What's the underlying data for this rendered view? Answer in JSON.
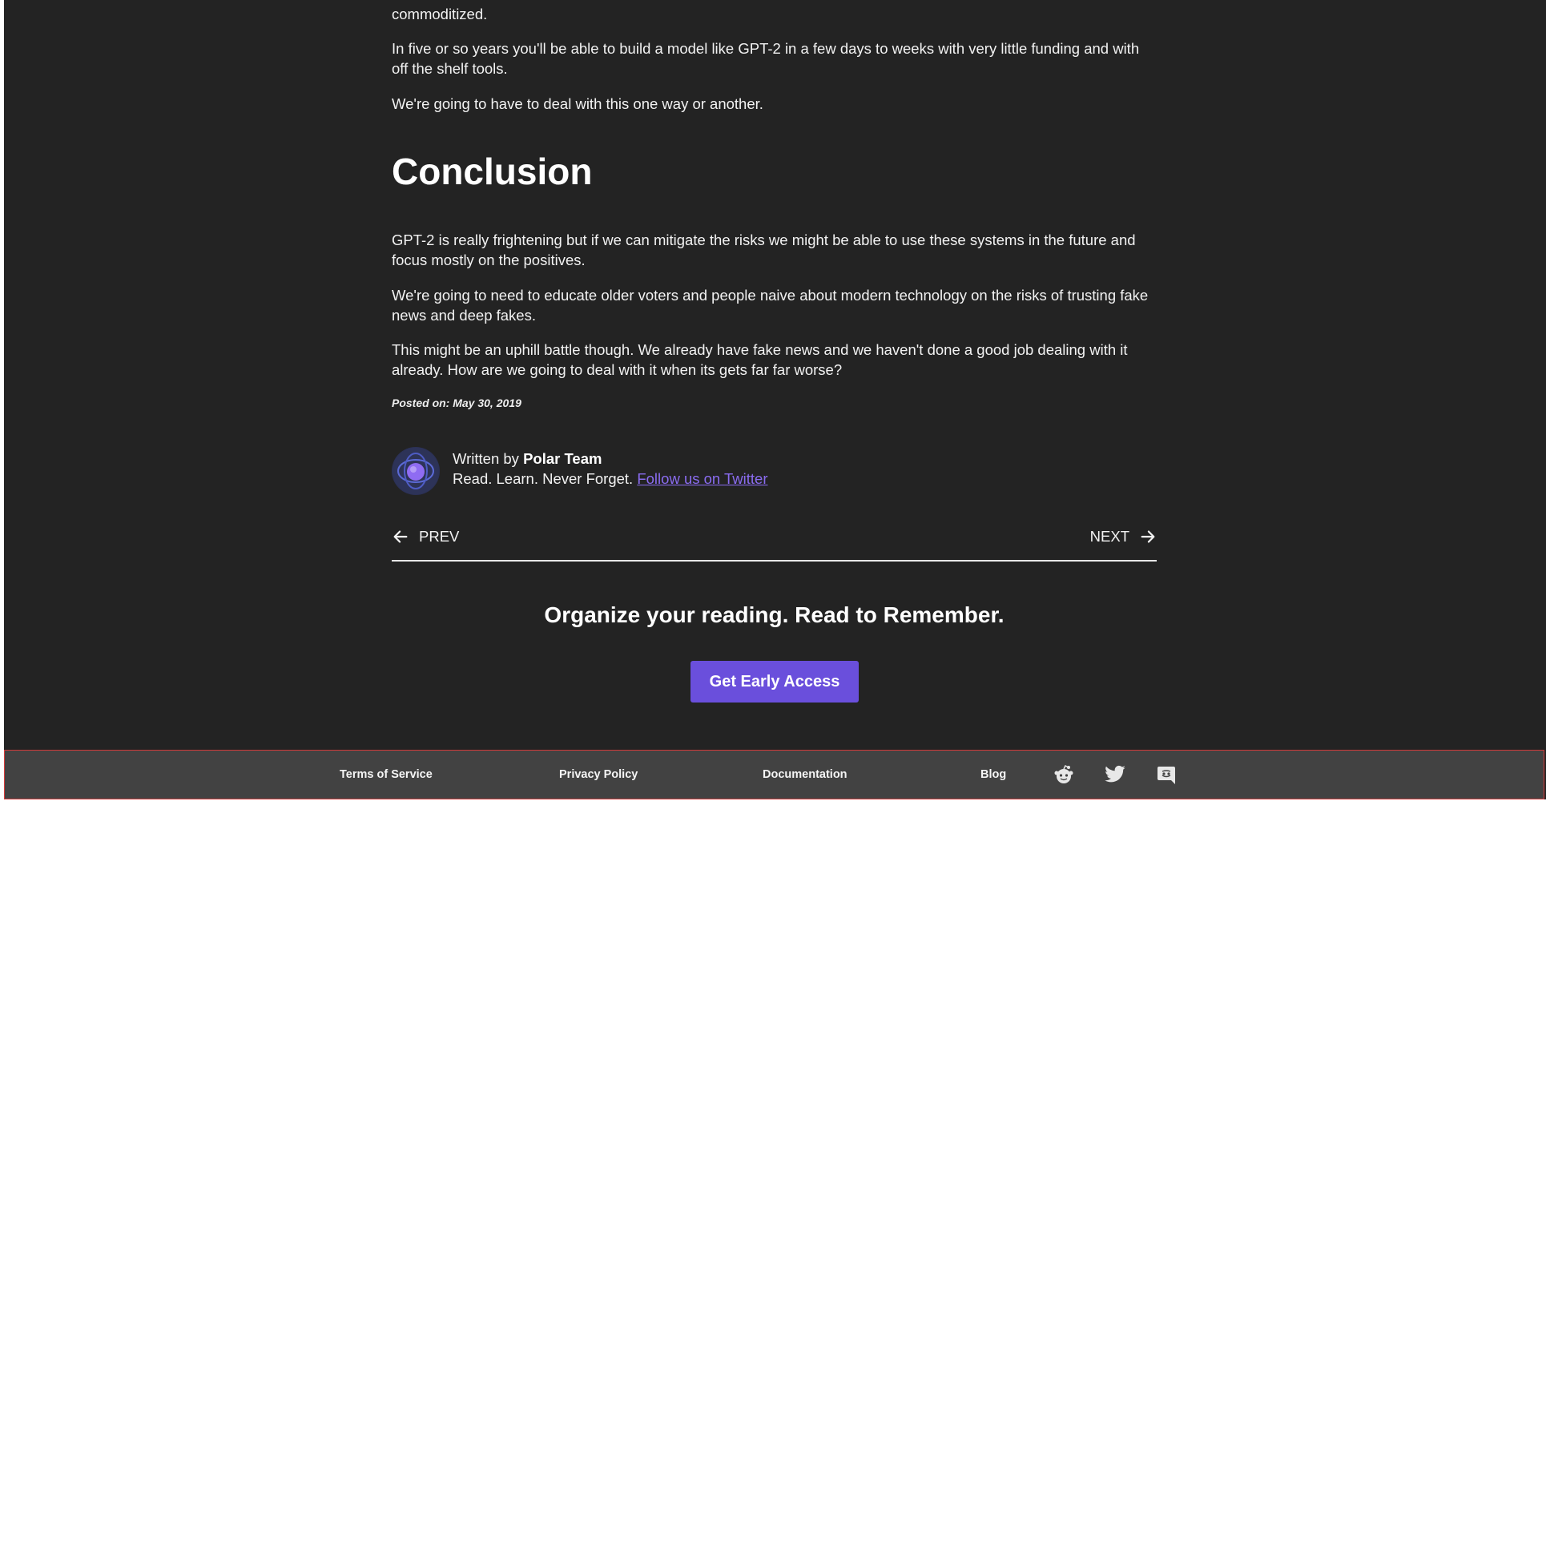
{
  "article": {
    "paragraphs_top": [
      "commoditized.",
      "In five or so years you'll be able to build a model like GPT-2 in a few days to weeks with very little funding and with off the shelf tools.",
      "We're going to have to deal with this one way or another."
    ],
    "heading": "Conclusion",
    "paragraphs_conclusion": [
      "GPT-2 is really frightening but if we can mitigate the risks we might be able to use these systems in the future and focus mostly on the positives.",
      "We're going to need to educate older voters and people naive about modern technology on the risks of trusting fake news and deep fakes.",
      "This might be an uphill battle though. We already have fake news and we haven't done a good job dealing with it already. How are we going to deal with it when its gets far far worse?"
    ],
    "posted_label": "Posted on:",
    "posted_date": "May 30, 2019"
  },
  "author": {
    "written_by": "Written by",
    "name": "Polar Team",
    "motto": "Read. Learn. Never Forget.",
    "twitter_link": "Follow us on Twitter"
  },
  "pager": {
    "prev": "PREV",
    "next": "NEXT"
  },
  "cta": {
    "tagline": "Organize your reading. Read to Remember.",
    "button": "Get Early Access",
    "color": "#6a4fdc"
  },
  "footer": {
    "links": [
      "Terms of Service",
      "Privacy Policy",
      "Documentation",
      "Blog"
    ],
    "icons": [
      "reddit-icon",
      "twitter-icon",
      "discord-icon"
    ]
  },
  "colors": {
    "background": "#232323",
    "footer": "#424242",
    "link": "#8a6cf0"
  }
}
